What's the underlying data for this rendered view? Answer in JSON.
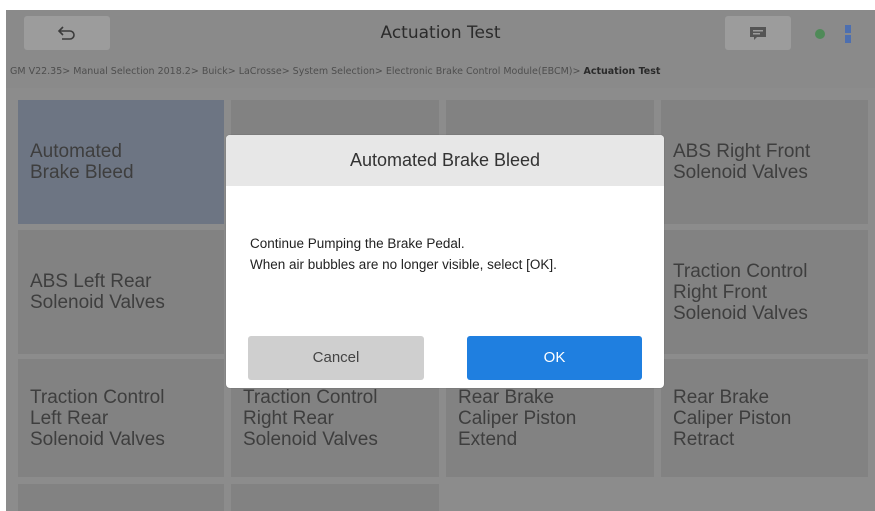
{
  "header": {
    "title": "Actuation Test",
    "back_icon": "back-icon",
    "chat_icon": "chat-icon"
  },
  "breadcrumb": {
    "path": "GM V22.35> Manual Selection 2018.2> Buick> LaCrosse> System Selection> Electronic Brake Control Module(EBCM)> ",
    "current": "Actuation Test"
  },
  "tiles": [
    {
      "line1": "Automated",
      "line2": "Brake Bleed",
      "line3": ""
    },
    {
      "line1": "",
      "line2": "",
      "line3": ""
    },
    {
      "line1": "",
      "line2": "",
      "line3": ""
    },
    {
      "line1": "ABS Right Front",
      "line2": "Solenoid Valves",
      "line3": ""
    },
    {
      "line1": "ABS Left Rear",
      "line2": "Solenoid Valves",
      "line3": ""
    },
    {
      "line1": "Traction Control",
      "line2": "Right Front",
      "line3": "Solenoid Valves"
    },
    {
      "line1": "Traction Control",
      "line2": "Left Rear",
      "line3": "Solenoid Valves"
    },
    {
      "line1": "Traction Control",
      "line2": "Right Rear",
      "line3": "Solenoid Valves"
    },
    {
      "line1": "Rear Brake",
      "line2": "Caliper Piston",
      "line3": "Extend"
    },
    {
      "line1": "Rear Brake",
      "line2": "Caliper Piston",
      "line3": "Retract"
    }
  ],
  "modal": {
    "title": "Automated Brake Bleed",
    "message_line1": "Continue Pumping the Brake Pedal.",
    "message_line2": "When air bubbles are no longer visible, select [OK].",
    "cancel_label": "Cancel",
    "ok_label": "OK"
  },
  "colors": {
    "ok_button": "#1f7fe0",
    "selected_tile": "#6d7583"
  }
}
